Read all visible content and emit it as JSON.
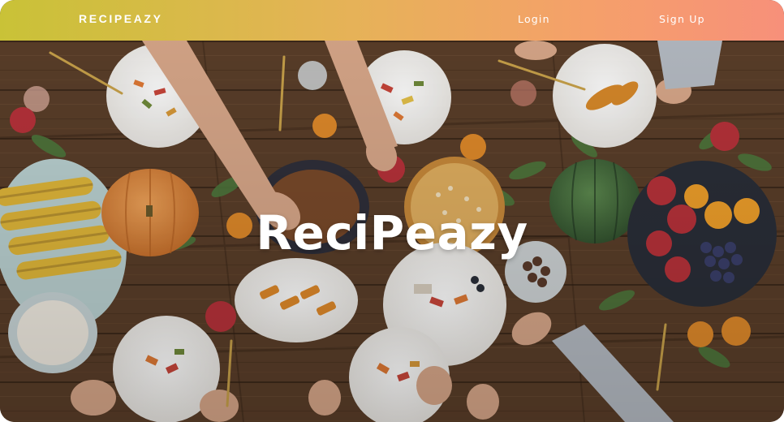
{
  "navbar": {
    "brand": "RECIPEAZY",
    "links": [
      {
        "label": "Login"
      },
      {
        "label": "Sign Up"
      }
    ]
  },
  "hero": {
    "title": "ReciPeazy",
    "background_image": "photo-of-festive-harvest-dinner-table-overhead"
  },
  "colors": {
    "nav_gradient_start": "#c9c237",
    "nav_gradient_end": "#f7907a",
    "wood_table": "#5a3e28",
    "text": "#ffffff"
  }
}
